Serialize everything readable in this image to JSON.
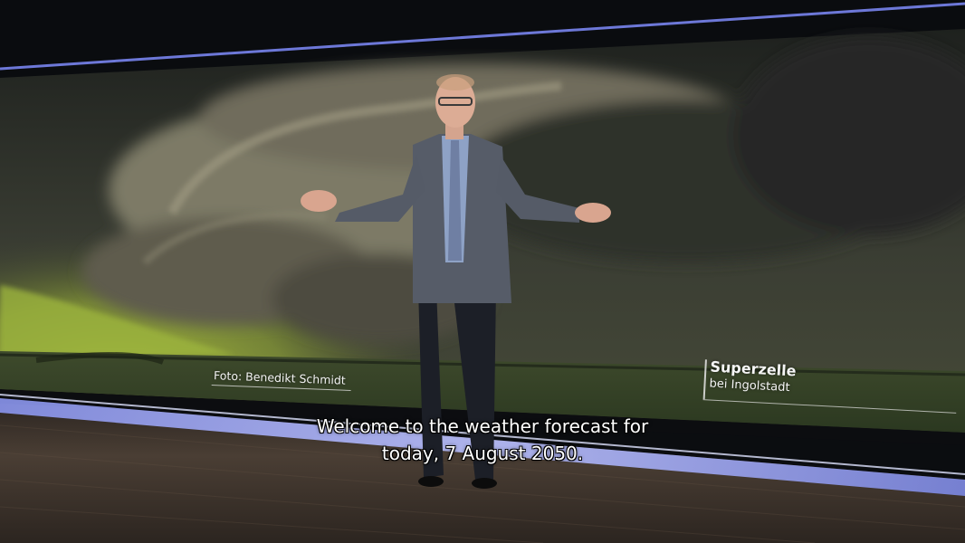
{
  "scene": {
    "kind": "weather broadcast still",
    "backdrop": "supercell storm cloud over green farmland",
    "colors": {
      "sky_dark": "#2b2e2a",
      "cloud": "#8a8670",
      "horizon_glow": "#8fa33a",
      "accent_band": "#7a86e6",
      "floor": "#3a322c"
    }
  },
  "photo_credit": "Foto: Benedikt Schmidt",
  "location_caption": {
    "title": "Superzelle",
    "subtitle": "bei Ingolstadt"
  },
  "subtitles": {
    "line1": "Welcome to the weather forecast for",
    "line2": "today, 7 August 2050."
  }
}
